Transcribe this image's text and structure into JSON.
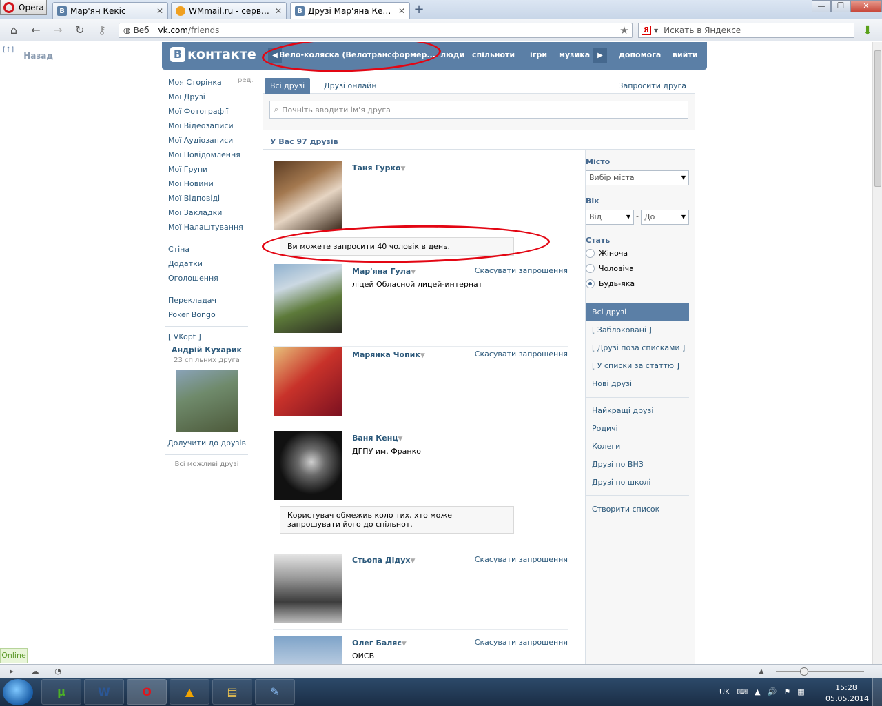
{
  "browser": {
    "menu_label": "Opera",
    "tabs": [
      {
        "label": "Мар'ян Кекіс",
        "icon": "vk-favicon",
        "active": false
      },
      {
        "label": "WMmail.ru - сервис п...",
        "icon": "wmmail-favicon",
        "active": false
      },
      {
        "label": "Друзі Мар'яна Кекіса |...",
        "icon": "vk-favicon",
        "active": true
      }
    ],
    "address": {
      "badge": "Веб",
      "host": "vk.com",
      "path": "/friends"
    },
    "search_placeholder": "Искать в Яндексе",
    "search_engine_letter": "Я"
  },
  "page": {
    "back": {
      "up": "[↑]",
      "label": "Назад"
    },
    "header": {
      "logo": "контакте",
      "logo_letter": "В",
      "nav": {
        "now_playing": "Вело-коляска (Велотрансформер...",
        "people": "люди",
        "communities": "спільноти",
        "games": "ігри",
        "music": "музика",
        "help": "допомога",
        "logout": "вийти"
      }
    },
    "left_menu": {
      "edit": "ред.",
      "items_main": [
        "Моя Сторінка",
        "Мої Друзі",
        "Мої Фотографії",
        "Мої Відеозаписи",
        "Мої Аудіозаписи",
        "Мої Повідомлення",
        "Мої Групи",
        "Мої Новини",
        "Мої Відповіді",
        "Мої Закладки",
        "Мої Налаштування"
      ],
      "items_apps": [
        "Стіна",
        "Додатки",
        "Оголошення"
      ],
      "items_extra": [
        "Перекладач",
        "Poker Bongo"
      ],
      "vkopt": "[ VKopt ]",
      "suggest": {
        "name": "Андрій Кухарик",
        "common": "23 спільних друга",
        "add": "Долучити до друзів",
        "all": "Всі можливі друзі"
      }
    },
    "friends_tabs": {
      "all": "Всі друзі",
      "online": "Друзі онлайн",
      "invite": "Запросити друга"
    },
    "search_placeholder": "Почніть вводити ім'я друга",
    "count": "У Вас 97 друзів",
    "friends": [
      {
        "name": "Таня Гурко",
        "sub": "",
        "cancel": ""
      },
      {
        "name": "Мар'яна Гула",
        "sub": "ліцей Обласной лицей-интернат",
        "cancel": "Скасувати запрошення"
      },
      {
        "name": "Марянка Чопик",
        "sub": "",
        "cancel": "Скасувати запрошення"
      },
      {
        "name": "Ваня Кенц",
        "sub": "ДГПУ им. Франко",
        "cancel": ""
      },
      {
        "name": "Стьопа Дідух",
        "sub": "",
        "cancel": "Скасувати запрошення"
      },
      {
        "name": "Олег Баляс",
        "sub": "ОИСВ",
        "cancel": "Скасувати запрошення"
      }
    ],
    "notices": {
      "limit": "Ви можете запросити 40 чоловік в день.",
      "restricted": "Користувач обмежив коло тих, хто може запрошувати його до спільнот."
    },
    "filter": {
      "city_label": "Місто",
      "city_value": "Вибір міста",
      "age_label": "Вік",
      "age_from": "Від",
      "age_to": "До",
      "age_dash": "-",
      "sex_label": "Стать",
      "sex_options": [
        "Жіноча",
        "Чоловіча",
        "Будь-яка"
      ],
      "sex_selected": "Будь-яка",
      "lists_a": [
        "Всі друзі",
        "[ Заблоковані ]",
        "[ Друзі поза списками ]",
        "[ У списки за статтю ]",
        "Нові друзі"
      ],
      "lists_b": [
        "Найкращі друзі",
        "Родичі",
        "Колеги",
        "Друзі по ВНЗ",
        "Друзі по школі"
      ],
      "create": "Створити список"
    },
    "online_badge": "Online"
  },
  "taskbar": {
    "lang": "UK",
    "time": "15:28",
    "date": "05.05.2014"
  },
  "colors": {
    "vk_blue": "#5b7fa6",
    "link": "#2b587a",
    "annotation_red": "#e30613"
  }
}
